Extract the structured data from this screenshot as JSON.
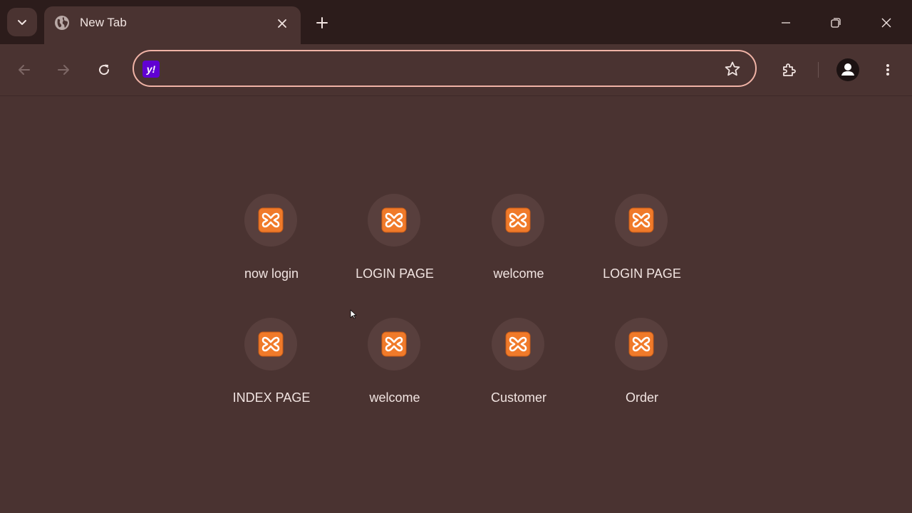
{
  "tab": {
    "title": "New Tab"
  },
  "omnibox": {
    "value": "",
    "search_engine_icon": "yahoo-icon",
    "search_engine_badge": "y!"
  },
  "colors": {
    "frame": "#2c1c1b",
    "surface": "#4a3331",
    "omnibox_border": "#f0b3a6",
    "tile_circle": "#583f3d",
    "xampp_orange": "#f07a2a",
    "yahoo_purple": "#6001d2",
    "text": "#f1e4e1"
  },
  "shortcuts": [
    {
      "label": "now login",
      "icon": "xampp-icon"
    },
    {
      "label": "LOGIN PAGE",
      "icon": "xampp-icon"
    },
    {
      "label": "welcome",
      "icon": "xampp-icon"
    },
    {
      "label": "LOGIN PAGE",
      "icon": "xampp-icon"
    },
    {
      "label": "INDEX PAGE",
      "icon": "xampp-icon"
    },
    {
      "label": "welcome",
      "icon": "xampp-icon"
    },
    {
      "label": "Customer",
      "icon": "xampp-icon"
    },
    {
      "label": "Order",
      "icon": "xampp-icon"
    }
  ]
}
